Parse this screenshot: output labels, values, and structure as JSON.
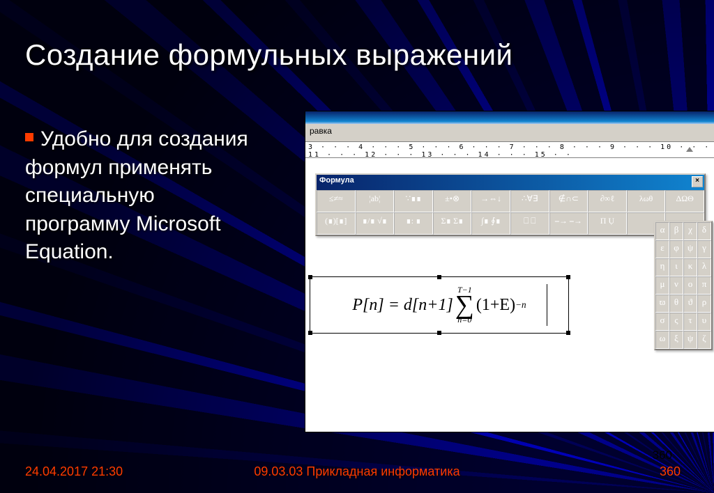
{
  "title": "Создание формульных выражений",
  "body": "Удобно для создания формул применять специальную программу Microsoft Equation.",
  "footer": {
    "date": "24.04.2017 21:30",
    "course": "09.03.03 Прикладная информатика",
    "page": "360"
  },
  "screenshot": {
    "menu_fragment": "равка",
    "ruler": "3 · · · 4 · · · 5 · · · 6 · · · 7 · · · 8 · · · 9 · · · 10 · · · 11 · · · 12 · · · 13 · · · 14 · · · 15 · ·",
    "eq_window_title": "Формула",
    "eq_row1": [
      "≤≠≈",
      "¦ab¦",
      "∵∎∎",
      "±•⊗",
      "→⇔↓",
      "∴∀∃",
      "∉∩⊂",
      "∂∞ℓ",
      "λωθ",
      "ΔΩΘ"
    ],
    "eq_row2": [
      "(∎)[∎]",
      "∎/∎ √∎",
      "∎: ∎",
      "Σ∎ Σ∎",
      "∫∎ ∮∎",
      "⎕ ⎕",
      "⎯→ ⎯→",
      "Π Ụ",
      "",
      ""
    ],
    "greek": [
      [
        "α",
        "β",
        "χ",
        "δ"
      ],
      [
        "ε",
        "φ",
        "ψ",
        "γ"
      ],
      [
        "η",
        "ι",
        "κ",
        "λ"
      ],
      [
        "μ",
        "ν",
        "ο",
        "π"
      ],
      [
        "ϖ",
        "θ",
        "ϑ",
        "ρ"
      ],
      [
        "σ",
        "ς",
        "τ",
        "υ"
      ],
      [
        "ω",
        "ξ",
        "ψ",
        "ζ"
      ]
    ],
    "formula": {
      "lhs": "P[n] = d[n+1]",
      "sigma_top": "T−1",
      "sigma_bot": "n=0",
      "rhs_base": "(1+E)",
      "rhs_exp": "−n"
    }
  }
}
